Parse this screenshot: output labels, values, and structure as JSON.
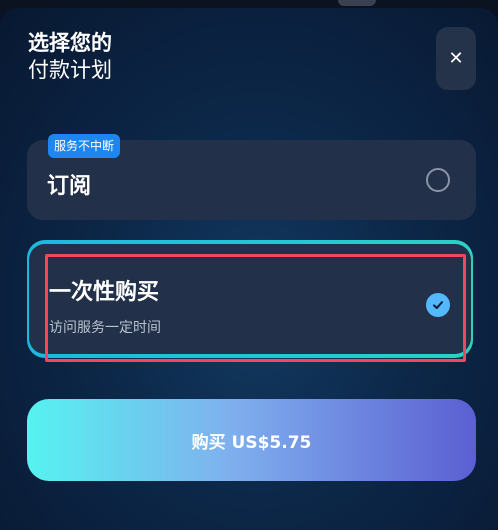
{
  "header": {
    "title_line1": "选择您的",
    "title_line2": "付款计划",
    "close_icon": "close-icon",
    "close_glyph": "✕"
  },
  "plans": [
    {
      "name": "订阅",
      "badge": "服务不中断",
      "selected": false
    },
    {
      "name": "一次性购买",
      "description": "访问服务一定时间",
      "selected": true
    }
  ],
  "buy_button": {
    "label": "购买 US$5.75"
  },
  "colors": {
    "accent": "#54b8ff",
    "badge": "#1e86f0",
    "highlight": "#f2475f"
  }
}
